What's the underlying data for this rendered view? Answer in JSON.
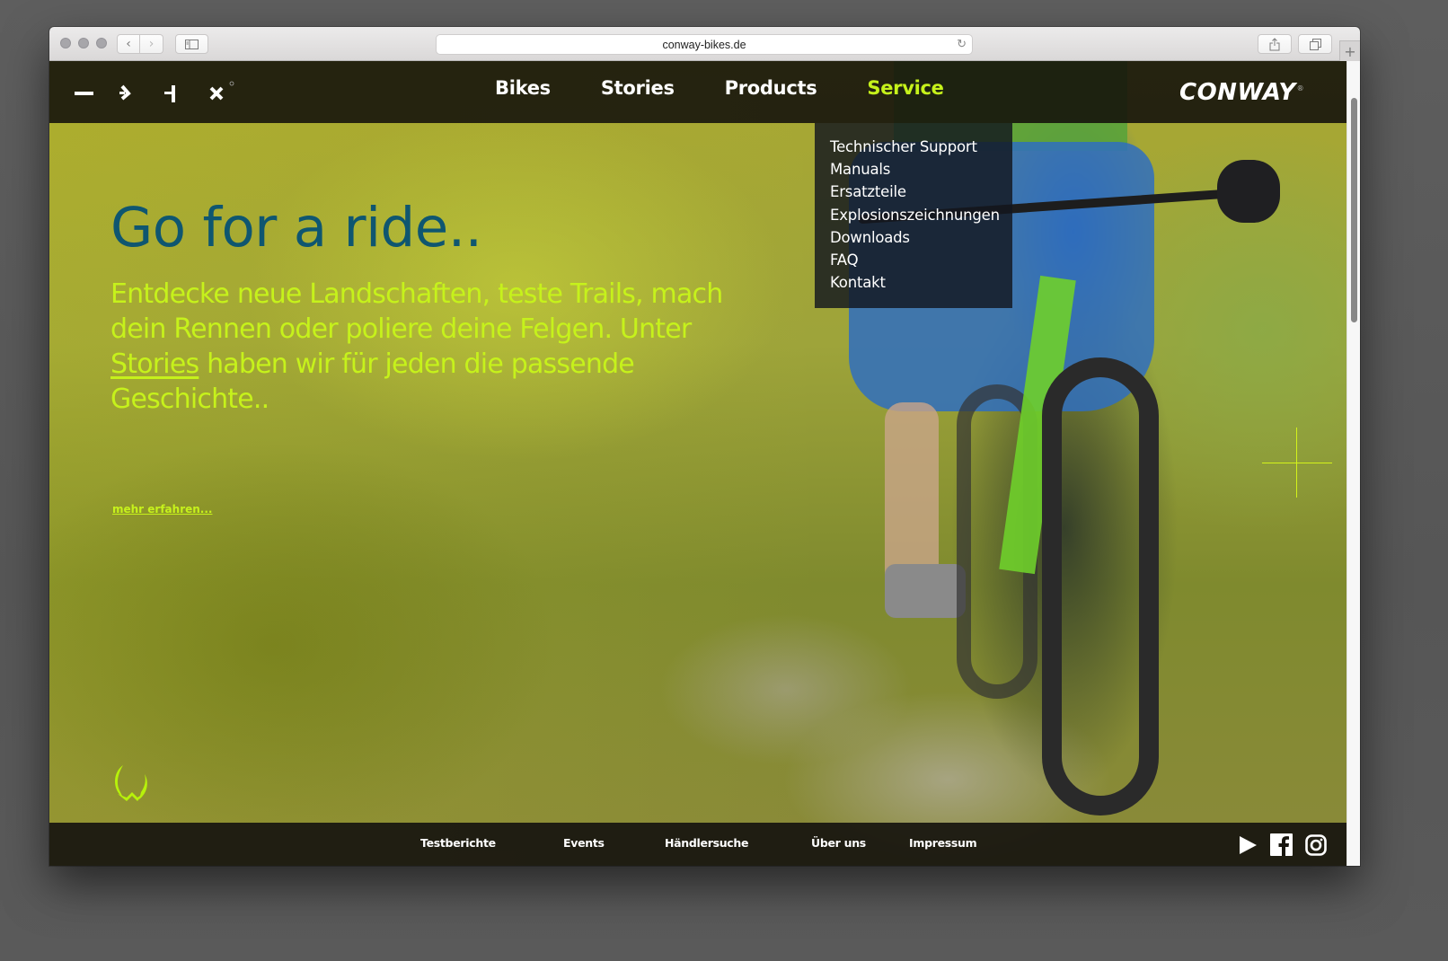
{
  "browser": {
    "url": "conway-bikes.de",
    "back_icon": "chevron-left-icon",
    "forward_icon": "chevron-right-icon",
    "sidebar_icon": "sidebar-icon",
    "reload_icon": "reload-icon",
    "share_icon": "share-icon",
    "tabs_icon": "tabs-icon",
    "new_tab_icon": "plus-icon",
    "glyphs": {
      "back": "‹",
      "forward": "›",
      "reload": "↻",
      "share": "⇪",
      "tabs": "⧉",
      "plus": "+"
    }
  },
  "header": {
    "logo_mark": "conway-monogram",
    "nav": [
      {
        "label": "Bikes",
        "active": false
      },
      {
        "label": "Stories",
        "active": false
      },
      {
        "label": "Products",
        "active": false
      },
      {
        "label": "Service",
        "active": true
      }
    ],
    "brand": "CONWAY",
    "brand_registered": "®"
  },
  "dropdown": {
    "parent": "Service",
    "items": [
      "Technischer Support",
      "Manuals",
      "Ersatzteile",
      "Explosionszeichnungen",
      "Downloads",
      "FAQ",
      "Kontakt"
    ]
  },
  "hero": {
    "headline": "Go for a ride..",
    "subcopy_before": "Entdecke neue Landschaften, teste Trails, mach dein Rennen oder poliere deine Felgen. Unter ",
    "subcopy_link": "Stories",
    "subcopy_after": " haben wir für jeden die passende Geschichte..",
    "more_link": "mehr erfahren...",
    "emblem_icon": "conway-emblem-icon",
    "crosshair_icon": "crosshair-icon"
  },
  "footer": {
    "links": [
      "Testberichte",
      "Events",
      "Händlersuche",
      "Über uns",
      "Impressum"
    ],
    "social": [
      "youtube-icon",
      "facebook-icon",
      "instagram-icon"
    ]
  },
  "colors": {
    "accent": "#c6f21b",
    "headline": "#0f5670",
    "header_bg": "#16140c",
    "dropdown_bg": "#12161e"
  }
}
